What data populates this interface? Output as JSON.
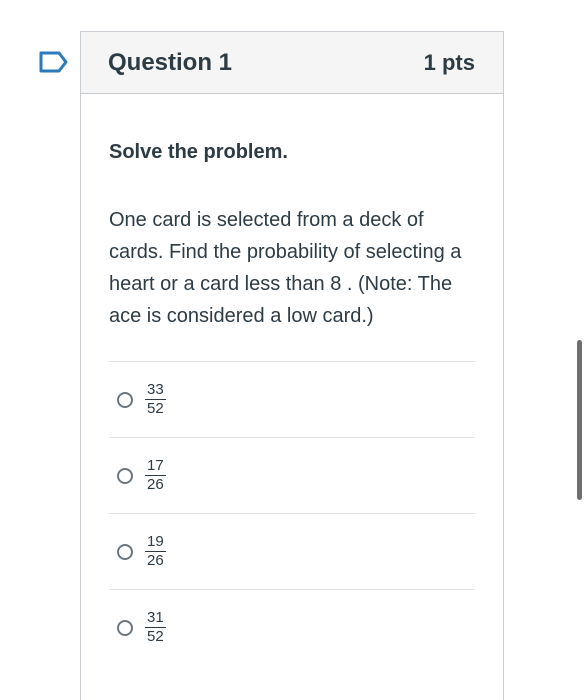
{
  "question": {
    "title": "Question 1",
    "points": "1 pts",
    "instructions": "Solve the problem.",
    "text": "One card is selected from a deck of cards. Find the probability of selecting a heart or a card less than 8 . (Note: The ace is considered a low card.)"
  },
  "answers": [
    {
      "numerator": "33",
      "denominator": "52"
    },
    {
      "numerator": "17",
      "denominator": "26"
    },
    {
      "numerator": "19",
      "denominator": "26"
    },
    {
      "numerator": "31",
      "denominator": "52"
    }
  ],
  "colors": {
    "text": "#2d3b45",
    "header_bg": "#f5f5f5",
    "border": "#c7cdd1",
    "flag": "#2b7abc"
  }
}
